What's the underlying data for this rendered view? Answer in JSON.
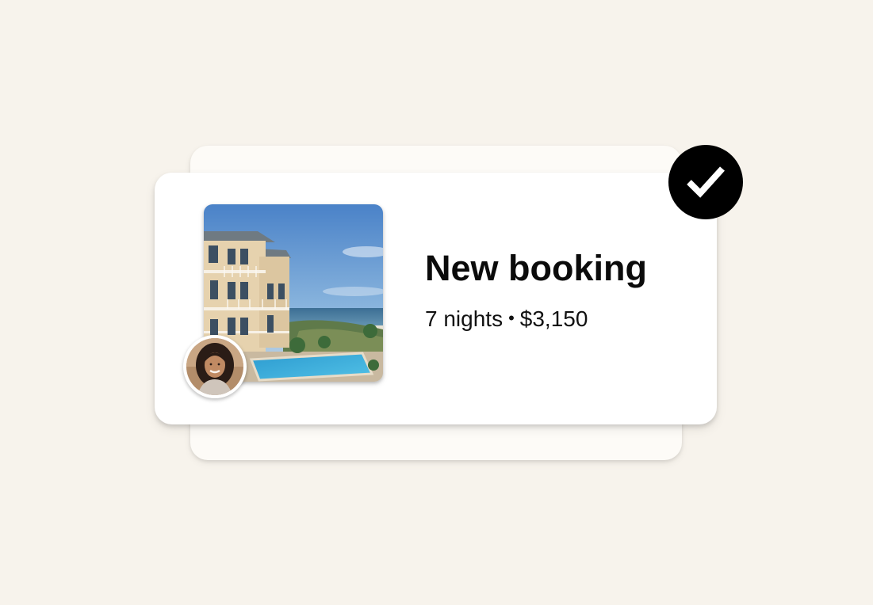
{
  "colors": {
    "background": "#f7f3ec",
    "back_card": "#fdfbf7",
    "front_card": "#ffffff",
    "badge": "#000000",
    "badge_check": "#ffffff"
  },
  "notification": {
    "title": "New booking",
    "nights": "7 nights",
    "separator": "•",
    "price": "$3,150"
  },
  "icons": {
    "status": "checkmark-icon",
    "photo": "beach-house-photo",
    "guest": "guest-avatar"
  }
}
